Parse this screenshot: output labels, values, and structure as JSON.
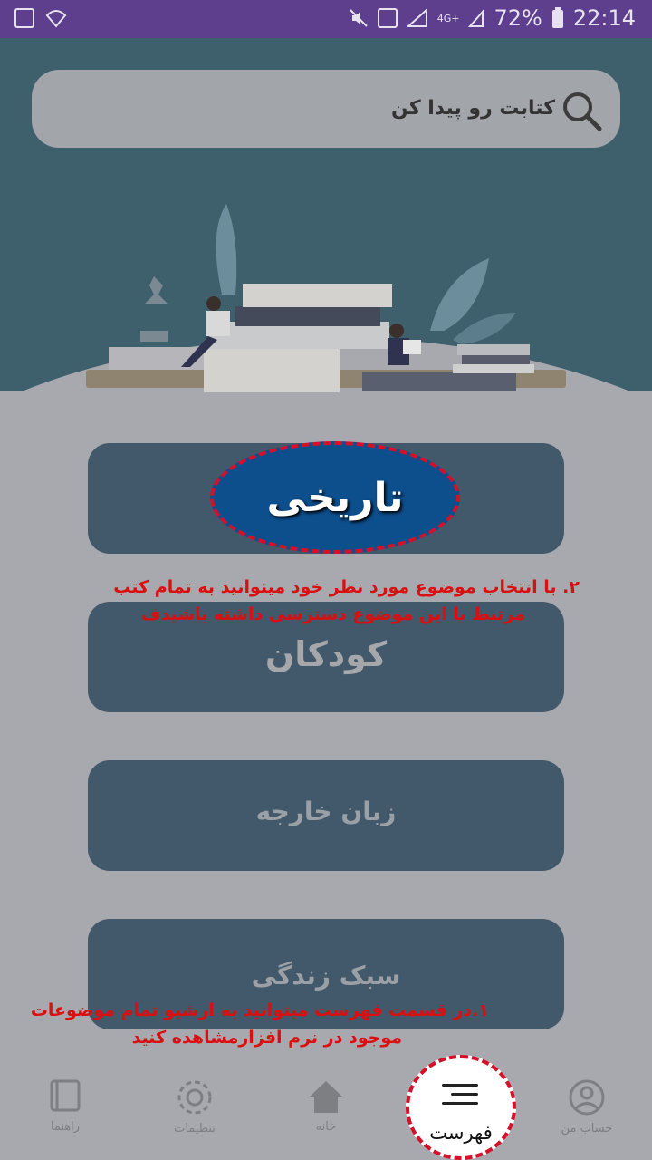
{
  "status_bar": {
    "battery": "72%",
    "time": "22:14",
    "network": "4G+"
  },
  "search": {
    "placeholder": "کتابت رو پیدا کن"
  },
  "categories": [
    {
      "label": "تاریخی"
    },
    {
      "label": "کودکان"
    },
    {
      "label": "زبان خارجه"
    },
    {
      "label": "سبک زندگی"
    }
  ],
  "annotations": {
    "step2_line1": "۲. با انتخاب موضوع مورد نظر خود میتوانید به تمام کتب",
    "step2_line2": "مرتبط با این موضوع دسترسی داشته باشیدف",
    "step1_line1": "۱.در قسمت فهرست میتوانید به ارشیو تمام موضوعات",
    "step1_line2": "موجود در نرم افزارمشاهده کنید"
  },
  "bottom_nav": {
    "guide": "راهنما",
    "settings": "تنظیمات",
    "home": "خانه",
    "menu": "فهرست",
    "account": "حساب من"
  },
  "colors": {
    "status_bar": "#5e3f8e",
    "header": "#3e5f6c",
    "card": "#41596b",
    "highlight_border": "#d6102a",
    "annotation": "#d90f10"
  }
}
